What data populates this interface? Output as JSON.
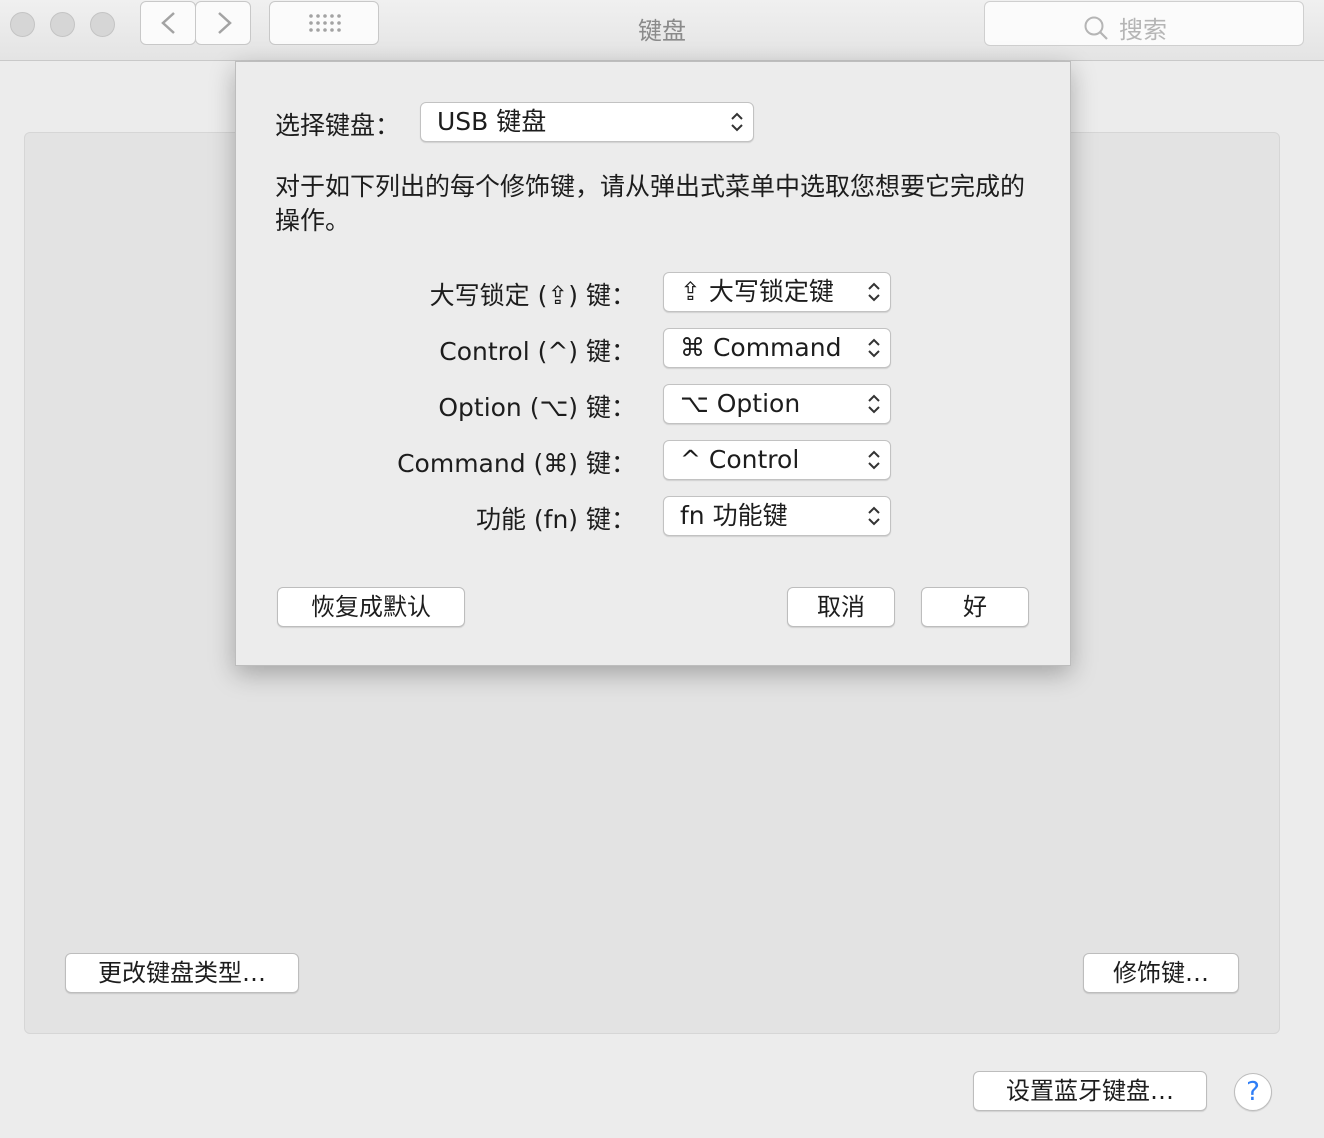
{
  "window": {
    "title": "键盘",
    "search_placeholder": "搜索"
  },
  "sheet": {
    "select_keyboard_label": "选择键盘：",
    "keyboard_value": "USB 键盘",
    "description": "对于如下列出的每个修饰键，请从弹出式菜单中选取您想要它完成的操作。",
    "rows": [
      {
        "label": "大写锁定 (⇪) 键：",
        "value": "⇪ 大写锁定键"
      },
      {
        "label": "Control (^) 键：",
        "value": "⌘ Command"
      },
      {
        "label": "Option (⌥) 键：",
        "value": "⌥ Option"
      },
      {
        "label": "Command (⌘) 键：",
        "value": "^ Control"
      },
      {
        "label": "功能 (fn) 键：",
        "value": "fn 功能键"
      }
    ],
    "restore_defaults": "恢复成默认",
    "cancel": "取消",
    "ok": "好"
  },
  "main": {
    "change_keyboard_type": "更改键盘类型…",
    "modifier_keys": "修饰键…",
    "setup_bluetooth": "设置蓝牙键盘…",
    "help": "?"
  },
  "colors": {
    "accent_help": "#2f7ef6",
    "window_bg": "#ececec"
  }
}
